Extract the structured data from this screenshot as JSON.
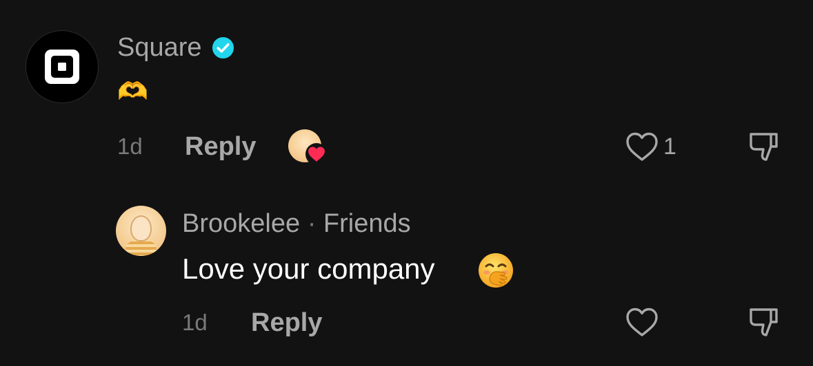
{
  "comment": {
    "username": "Square",
    "verified": true,
    "text_emoji": "🫶",
    "time": "1d",
    "reply_label": "Reply",
    "like_count": "1",
    "liked_by_creator": true
  },
  "reply": {
    "username": "Brookelee",
    "separator": "·",
    "relation": "Friends",
    "text": "Love your company",
    "text_emoji": "🤭",
    "time": "1d",
    "reply_label": "Reply"
  },
  "colors": {
    "background": "#121212",
    "verified_badge": "#20d5ec",
    "heart_badge": "#fe2c55",
    "muted_text": "#a8a8a8"
  }
}
